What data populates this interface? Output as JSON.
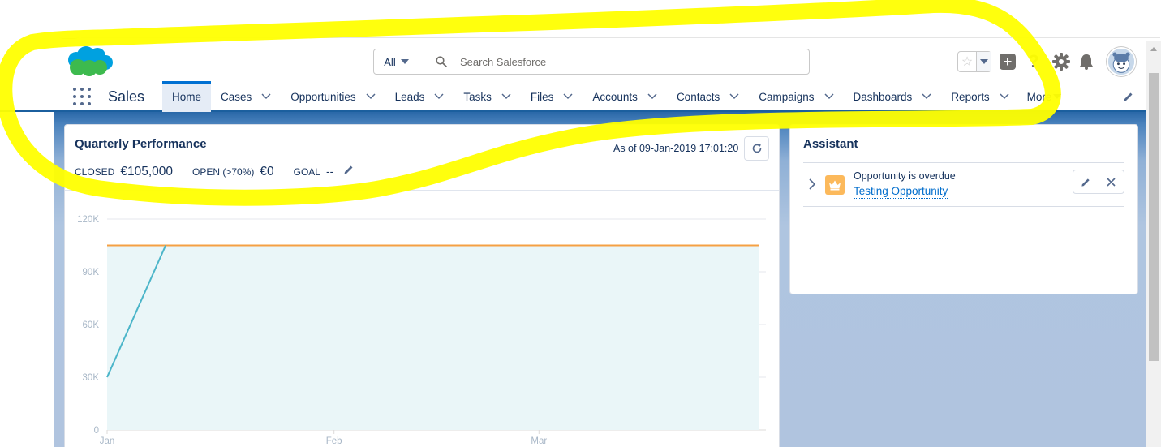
{
  "header": {
    "search_scope": "All",
    "search_placeholder": "Search Salesforce"
  },
  "nav": {
    "app_name": "Sales",
    "tabs": [
      {
        "label": "Home",
        "active": true,
        "menu": false
      },
      {
        "label": "Cases",
        "active": false,
        "menu": true
      },
      {
        "label": "Opportunities",
        "active": false,
        "menu": true
      },
      {
        "label": "Leads",
        "active": false,
        "menu": true
      },
      {
        "label": "Tasks",
        "active": false,
        "menu": true
      },
      {
        "label": "Files",
        "active": false,
        "menu": true
      },
      {
        "label": "Accounts",
        "active": false,
        "menu": true
      },
      {
        "label": "Contacts",
        "active": false,
        "menu": true
      },
      {
        "label": "Campaigns",
        "active": false,
        "menu": true
      },
      {
        "label": "Dashboards",
        "active": false,
        "menu": true
      },
      {
        "label": "Reports",
        "active": false,
        "menu": true
      }
    ],
    "more_label": "More"
  },
  "performance": {
    "title": "Quarterly Performance",
    "as_of": "As of 09-Jan-2019 17:01:20",
    "closed_label": "CLOSED",
    "closed_value": "€105,000",
    "open_label": "OPEN (>70%)",
    "open_value": "€0",
    "goal_label": "GOAL",
    "goal_value": "--"
  },
  "assistant": {
    "title": "Assistant",
    "item_message": "Opportunity is overdue",
    "item_link": "Testing Opportunity"
  },
  "colors": {
    "brand_blue": "#0070d2",
    "link_blue": "#006dcc",
    "closed_line": "#4bb5c9",
    "goal_line": "#f5a043",
    "area_fill": "#eaf6f8",
    "annotation": "#ffff00"
  },
  "chart_data": {
    "type": "line",
    "x_tick_labels": [
      "Jan",
      "Feb",
      "Mar"
    ],
    "y_tick_labels": [
      "0",
      "30K",
      "60K",
      "90K",
      "120K"
    ],
    "ylim": [
      0,
      120000
    ],
    "series": [
      {
        "role": "closed",
        "x": [
          "2019-01-01",
          "2019-01-09"
        ],
        "y": [
          30000,
          105000
        ]
      },
      {
        "role": "goal_reference",
        "x": [
          "2019-01-01",
          "2019-03-31"
        ],
        "y": [
          105000,
          105000
        ]
      }
    ]
  }
}
